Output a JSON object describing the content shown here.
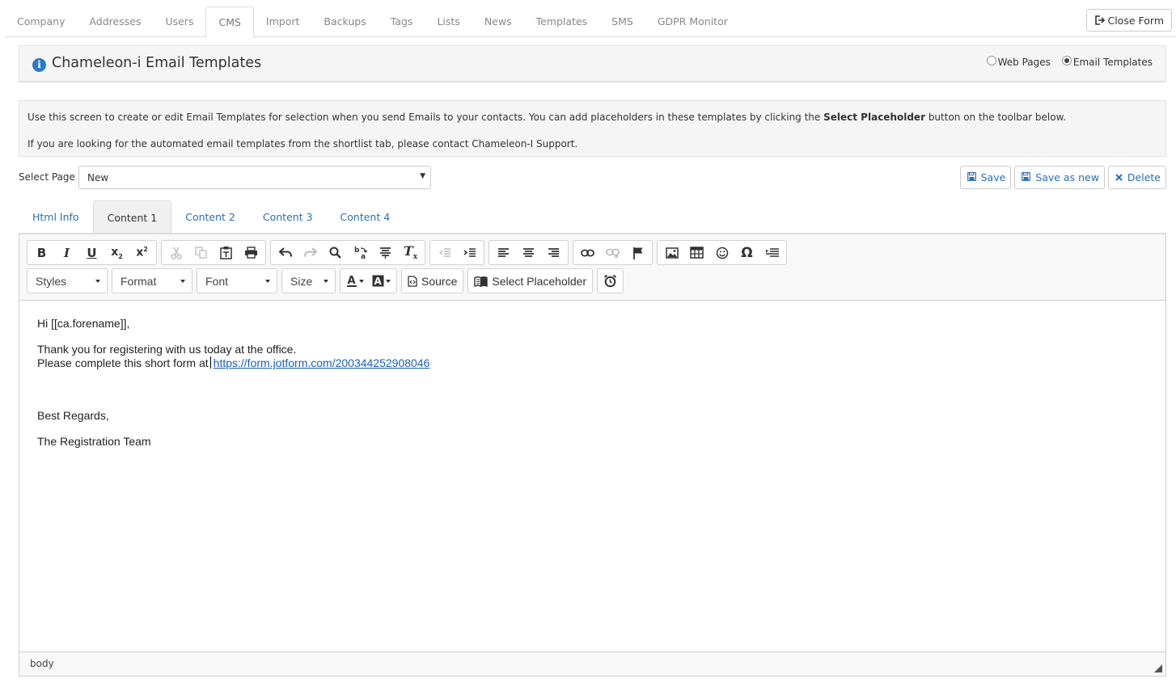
{
  "top_tabs": [
    "Company",
    "Addresses",
    "Users",
    "CMS",
    "Import",
    "Backups",
    "Tags",
    "Lists",
    "News",
    "Templates",
    "SMS",
    "GDPR Monitor"
  ],
  "active_top_tab": "CMS",
  "close_form_label": "Close Form",
  "title": "Chameleon-i Email Templates",
  "radio": {
    "web_pages": "Web Pages",
    "email_templates": "Email Templates",
    "selected": "email_templates"
  },
  "info": {
    "line1_before": "Use this screen to create or edit Email Templates for selection when you send Emails to your contacts. You can add placeholders in these templates by clicking the ",
    "line1_bold": "Select Placeholder",
    "line1_after": " button on the toolbar below.",
    "line2": "If you are looking for the automated email templates from the shortlist tab, please contact Chameleon-I Support."
  },
  "select_page": {
    "label": "Select Page",
    "value": "New"
  },
  "actions": {
    "save": "Save",
    "save_as_new": "Save as new",
    "delete": "Delete"
  },
  "content_tabs": [
    "Html Info",
    "Content 1",
    "Content 2",
    "Content 3",
    "Content 4"
  ],
  "active_content_tab": "Content 1",
  "toolbar": {
    "styles": "Styles",
    "format": "Format",
    "font": "Font",
    "size": "Size",
    "source": "Source",
    "select_placeholder": "Select Placeholder"
  },
  "editor_content": {
    "greeting": "Hi [[ca.forename]],",
    "line1": "Thank you for registering with us today at the office.",
    "line2_prefix": "Please complete this short form at",
    "link": "https://form.jotform.com/200344252908046",
    "signoff": "Best Regards,",
    "team": "The Registration Team"
  },
  "status_path": "body",
  "colors": {
    "link": "#1a5fb4",
    "info_icon": "#2a7bc8",
    "action_text": "#2a6fb5"
  }
}
